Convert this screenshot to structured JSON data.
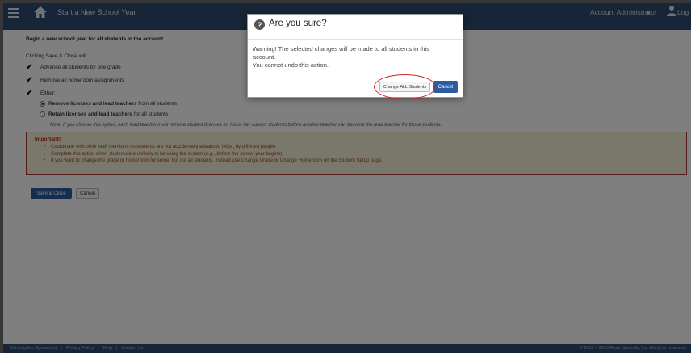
{
  "header": {
    "title": "Start a New School Year",
    "account": "Account Administrator",
    "logout": "Log O"
  },
  "main": {
    "heading": "Begin a new school year for all students in the account",
    "intro": "Clicking Save & Close will:",
    "items": [
      "Advance all students by one grade",
      "Remove all homeroom assignments",
      "Either:"
    ],
    "options": [
      {
        "bold": "Remove licenses and lead teachers",
        "rest": " from all students",
        "selected": true
      },
      {
        "bold": "Retain licenses and lead teachers",
        "rest": " for all students",
        "selected": false
      }
    ],
    "note": "Note: If you choose this option, each lead teacher must remove student licenses for his or her current students before another teacher can become the lead teacher for those students.",
    "important": {
      "title": "Important!",
      "bullets": [
        "Coordinate with other staff members so students are not accidentally advanced twice, by different people.",
        "Complete this action when students are unlikely to be using the system (e.g., before the school year begins).",
        "If you want to change the grade or homeroom for some, but not all students, instead use Change Grade or Change Homeroom on the Student Setup page."
      ]
    },
    "save_label": "Save & Close",
    "cancel_label": "Cancel"
  },
  "footer": {
    "links": [
      "Subscription Agreement",
      "|",
      "Privacy Policy",
      "|",
      "Help",
      "|",
      "Contact Us"
    ],
    "copyright": "© 2011 – 2023 Read Naturally, Inc. All rights reserved."
  },
  "modal": {
    "title": "Are you sure?",
    "body_lines": [
      "Warning! The selected changes will be made to all students in this",
      "account.",
      "You cannot undo this action."
    ],
    "confirm_label": "Change ALL Students",
    "cancel_label": "Cancel"
  },
  "colors": {
    "header_bg": "#2d4a6f",
    "primary_button": "#2a5d9f",
    "important_border": "#a83a2e",
    "important_bg": "#f4f0d6",
    "highlight_ring": "#d42424"
  },
  "icons": {
    "menu": "hamburger-icon",
    "home": "home-icon",
    "dropdown": "caret-down-icon",
    "user": "user-icon",
    "check": "checkmark-icon",
    "question": "question-circle-icon"
  }
}
